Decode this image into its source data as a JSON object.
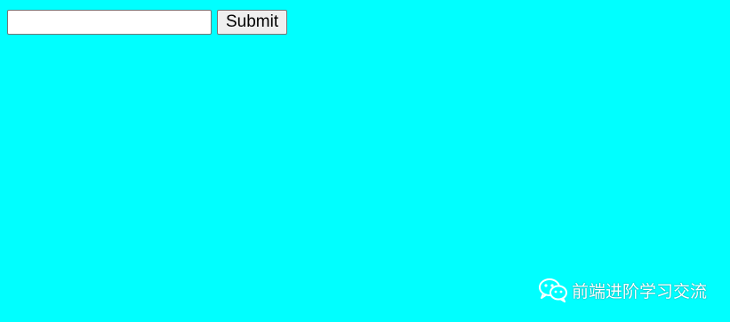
{
  "page": {
    "background_color": "#00ffff"
  },
  "form": {
    "input_value": "",
    "input_placeholder": "",
    "submit_label": "Submit"
  },
  "watermark": {
    "icon": "wechat-icon",
    "text": "前端进阶学习交流"
  }
}
